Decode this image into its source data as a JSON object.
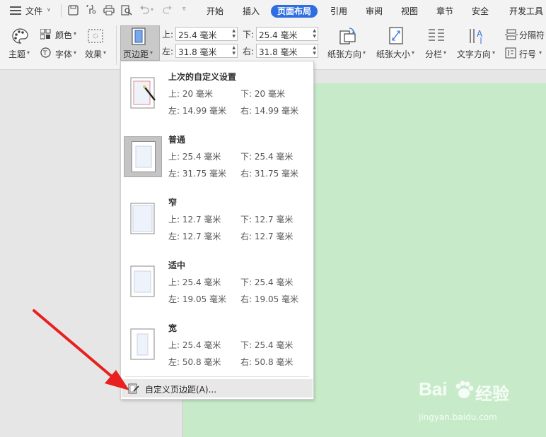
{
  "titlebar": {
    "file_label": "文件",
    "tabs": [
      "开始",
      "插入",
      "页面布局",
      "引用",
      "审阅",
      "视图",
      "章节",
      "安全",
      "开发工具"
    ],
    "active_tab": "页面布局"
  },
  "ribbon": {
    "theme_label": "主题",
    "colors_label": "颜色",
    "fonts_label": "字体",
    "effects_label": "效果",
    "margins_label": "页边距",
    "margin_top_label": "上:",
    "margin_bottom_label": "下:",
    "margin_left_label": "左:",
    "margin_right_label": "右:",
    "margin_top_value": "25.4 毫米",
    "margin_bottom_value": "25.4 毫米",
    "margin_left_value": "31.8 毫米",
    "margin_right_value": "31.8 毫米",
    "orientation_label": "纸张方向",
    "size_label": "纸张大小",
    "columns_label": "分栏",
    "text_direction_label": "文字方向",
    "breaks_label": "分隔符",
    "line_numbers_label": "行号"
  },
  "margins_menu": {
    "presets": [
      {
        "name": "上次的自定义设置",
        "top": "上: 20 毫米",
        "bottom": "下: 20 毫米",
        "left": "左: 14.99 毫米",
        "right": "右: 14.99 毫米"
      },
      {
        "name": "普通",
        "top": "上: 25.4 毫米",
        "bottom": "下: 25.4 毫米",
        "left": "左: 31.75 毫米",
        "right": "右: 31.75 毫米"
      },
      {
        "name": "窄",
        "top": "上: 12.7 毫米",
        "bottom": "下: 12.7 毫米",
        "left": "左: 12.7 毫米",
        "right": "右: 12.7 毫米"
      },
      {
        "name": "适中",
        "top": "上: 25.4 毫米",
        "bottom": "下: 25.4 毫米",
        "left": "左: 19.05 毫米",
        "right": "右: 19.05 毫米"
      },
      {
        "name": "宽",
        "top": "上: 25.4 毫米",
        "bottom": "下: 25.4 毫米",
        "left": "左: 50.8 毫米",
        "right": "右: 50.8 毫米"
      }
    ],
    "custom_label": "自定义页边距(A)..."
  },
  "watermark": {
    "brand": "Bai",
    "brand_cn": "经验",
    "url": "jingyan.baidu.com"
  },
  "colors": {
    "accent": "#2f6ee0",
    "page": "#c7ebc9",
    "arrow": "#e8201f"
  }
}
